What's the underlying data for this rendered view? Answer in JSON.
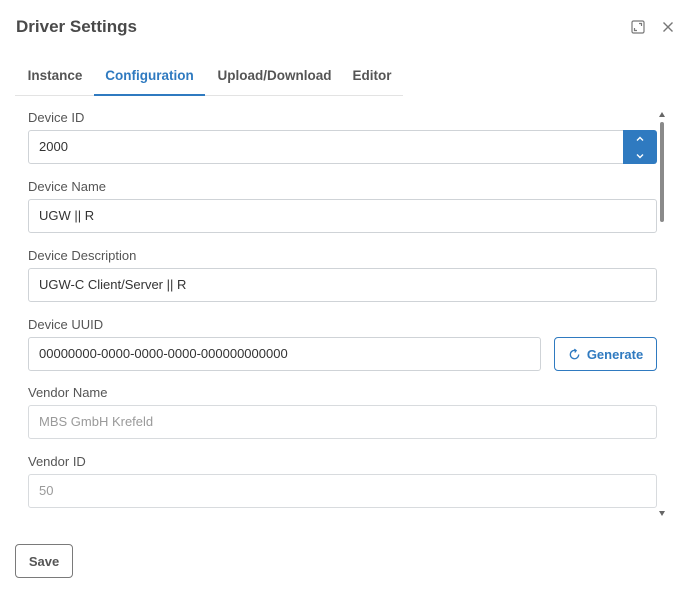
{
  "dialog": {
    "title": "Driver Settings",
    "expand_icon": "expand-icon",
    "close_icon": "close-icon"
  },
  "tabs": [
    {
      "label": "Instance",
      "active": false
    },
    {
      "label": "Configuration",
      "active": true
    },
    {
      "label": "Upload/Download",
      "active": false
    },
    {
      "label": "Editor",
      "active": false
    }
  ],
  "fields": {
    "device_id": {
      "label": "Device ID",
      "value": "2000"
    },
    "device_name": {
      "label": "Device Name",
      "value": "UGW || R"
    },
    "device_description": {
      "label": "Device Description",
      "value": "UGW-C Client/Server || R"
    },
    "device_uuid": {
      "label": "Device UUID",
      "value": "00000000-0000-0000-0000-000000000000"
    },
    "vendor_name": {
      "label": "Vendor Name",
      "value": "MBS GmbH Krefeld"
    },
    "vendor_id": {
      "label": "Vendor ID",
      "value": "50"
    }
  },
  "generate_button": {
    "label": "Generate",
    "icon": "refresh-icon"
  },
  "footer": {
    "save_label": "Save"
  },
  "colors": {
    "accent": "#2f7ac0",
    "border": "#cfd3d7",
    "text": "#3a3a3a"
  }
}
